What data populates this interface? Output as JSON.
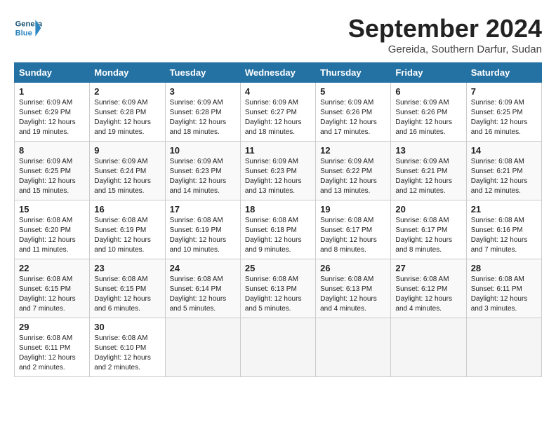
{
  "header": {
    "logo_general": "General",
    "logo_blue": "Blue",
    "month": "September 2024",
    "location": "Gereida, Southern Darfur, Sudan"
  },
  "weekdays": [
    "Sunday",
    "Monday",
    "Tuesday",
    "Wednesday",
    "Thursday",
    "Friday",
    "Saturday"
  ],
  "weeks": [
    [
      {
        "day": "1",
        "sunrise": "6:09 AM",
        "sunset": "6:29 PM",
        "daylight": "12 hours and 19 minutes."
      },
      {
        "day": "2",
        "sunrise": "6:09 AM",
        "sunset": "6:28 PM",
        "daylight": "12 hours and 19 minutes."
      },
      {
        "day": "3",
        "sunrise": "6:09 AM",
        "sunset": "6:28 PM",
        "daylight": "12 hours and 18 minutes."
      },
      {
        "day": "4",
        "sunrise": "6:09 AM",
        "sunset": "6:27 PM",
        "daylight": "12 hours and 18 minutes."
      },
      {
        "day": "5",
        "sunrise": "6:09 AM",
        "sunset": "6:26 PM",
        "daylight": "12 hours and 17 minutes."
      },
      {
        "day": "6",
        "sunrise": "6:09 AM",
        "sunset": "6:26 PM",
        "daylight": "12 hours and 16 minutes."
      },
      {
        "day": "7",
        "sunrise": "6:09 AM",
        "sunset": "6:25 PM",
        "daylight": "12 hours and 16 minutes."
      }
    ],
    [
      {
        "day": "8",
        "sunrise": "6:09 AM",
        "sunset": "6:25 PM",
        "daylight": "12 hours and 15 minutes."
      },
      {
        "day": "9",
        "sunrise": "6:09 AM",
        "sunset": "6:24 PM",
        "daylight": "12 hours and 15 minutes."
      },
      {
        "day": "10",
        "sunrise": "6:09 AM",
        "sunset": "6:23 PM",
        "daylight": "12 hours and 14 minutes."
      },
      {
        "day": "11",
        "sunrise": "6:09 AM",
        "sunset": "6:23 PM",
        "daylight": "12 hours and 13 minutes."
      },
      {
        "day": "12",
        "sunrise": "6:09 AM",
        "sunset": "6:22 PM",
        "daylight": "12 hours and 13 minutes."
      },
      {
        "day": "13",
        "sunrise": "6:09 AM",
        "sunset": "6:21 PM",
        "daylight": "12 hours and 12 minutes."
      },
      {
        "day": "14",
        "sunrise": "6:08 AM",
        "sunset": "6:21 PM",
        "daylight": "12 hours and 12 minutes."
      }
    ],
    [
      {
        "day": "15",
        "sunrise": "6:08 AM",
        "sunset": "6:20 PM",
        "daylight": "12 hours and 11 minutes."
      },
      {
        "day": "16",
        "sunrise": "6:08 AM",
        "sunset": "6:19 PM",
        "daylight": "12 hours and 10 minutes."
      },
      {
        "day": "17",
        "sunrise": "6:08 AM",
        "sunset": "6:19 PM",
        "daylight": "12 hours and 10 minutes."
      },
      {
        "day": "18",
        "sunrise": "6:08 AM",
        "sunset": "6:18 PM",
        "daylight": "12 hours and 9 minutes."
      },
      {
        "day": "19",
        "sunrise": "6:08 AM",
        "sunset": "6:17 PM",
        "daylight": "12 hours and 8 minutes."
      },
      {
        "day": "20",
        "sunrise": "6:08 AM",
        "sunset": "6:17 PM",
        "daylight": "12 hours and 8 minutes."
      },
      {
        "day": "21",
        "sunrise": "6:08 AM",
        "sunset": "6:16 PM",
        "daylight": "12 hours and 7 minutes."
      }
    ],
    [
      {
        "day": "22",
        "sunrise": "6:08 AM",
        "sunset": "6:15 PM",
        "daylight": "12 hours and 7 minutes."
      },
      {
        "day": "23",
        "sunrise": "6:08 AM",
        "sunset": "6:15 PM",
        "daylight": "12 hours and 6 minutes."
      },
      {
        "day": "24",
        "sunrise": "6:08 AM",
        "sunset": "6:14 PM",
        "daylight": "12 hours and 5 minutes."
      },
      {
        "day": "25",
        "sunrise": "6:08 AM",
        "sunset": "6:13 PM",
        "daylight": "12 hours and 5 minutes."
      },
      {
        "day": "26",
        "sunrise": "6:08 AM",
        "sunset": "6:13 PM",
        "daylight": "12 hours and 4 minutes."
      },
      {
        "day": "27",
        "sunrise": "6:08 AM",
        "sunset": "6:12 PM",
        "daylight": "12 hours and 4 minutes."
      },
      {
        "day": "28",
        "sunrise": "6:08 AM",
        "sunset": "6:11 PM",
        "daylight": "12 hours and 3 minutes."
      }
    ],
    [
      {
        "day": "29",
        "sunrise": "6:08 AM",
        "sunset": "6:11 PM",
        "daylight": "12 hours and 2 minutes."
      },
      {
        "day": "30",
        "sunrise": "6:08 AM",
        "sunset": "6:10 PM",
        "daylight": "12 hours and 2 minutes."
      },
      null,
      null,
      null,
      null,
      null
    ]
  ]
}
